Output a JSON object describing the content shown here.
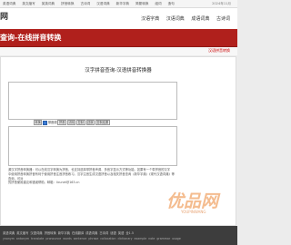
{
  "topbar": {
    "links": [
      "英语词典",
      "英文缩写",
      "英英词典",
      "拼音转换",
      "古诗词",
      "汉语词典",
      "新华字典",
      "简繁转换",
      "组词",
      "造句"
    ],
    "date": "2024年11月"
  },
  "header": {
    "logo": "网",
    "nav": [
      "汉语字典",
      "汉语词典",
      "成语词典",
      "古诗词"
    ]
  },
  "banner": {
    "title": "查询-在线拼音转换"
  },
  "breadcrumb": {
    "label": "汉语拼音转换"
  },
  "tool": {
    "title": "汉字拼音查询-汉语拼音转换器",
    "input_text": "",
    "output_text": "",
    "buttons": {
      "convert": "转换",
      "pinyin": "拼音",
      "clear": "清除",
      "copy": "复制",
      "restore": "还原",
      "copy_result": "复制结果"
    },
    "checkbox_label": "带音调"
  },
  "description": {
    "line1": "源汉字拼音转换器：可以在线汉字转换为拼音，也支持选择带拼音声调、多音字显示方式等功能。如果有一个带拼音的汉字",
    "line2": "中使用拼音转换拼音有利于使用拼音注音拼音练习。汉字注音生成汉语拼音以及相关拼音查询（新华字典）《现代汉语词典》等查询，可对",
    "line3": "的拼音使用建议和错误帮助。邮箱：licunet@163.cn"
  },
  "footer": {
    "links": [
      "英语词典",
      "英文缩写",
      "汉语词典",
      "拼音转换",
      "新华字典",
      "在线翻译",
      "成语词典",
      "古诗词",
      "谜语",
      "英语",
      "全1.5"
    ],
    "links2": [
      "ynonym",
      "antonym",
      "translate",
      "pronounce",
      "words",
      "sentence",
      "phrase",
      "collocation",
      "dictionary",
      "example",
      "note",
      "grammar",
      "usage"
    ]
  },
  "watermark": {
    "text": "优品网",
    "sub": "YOUPINWANG"
  }
}
